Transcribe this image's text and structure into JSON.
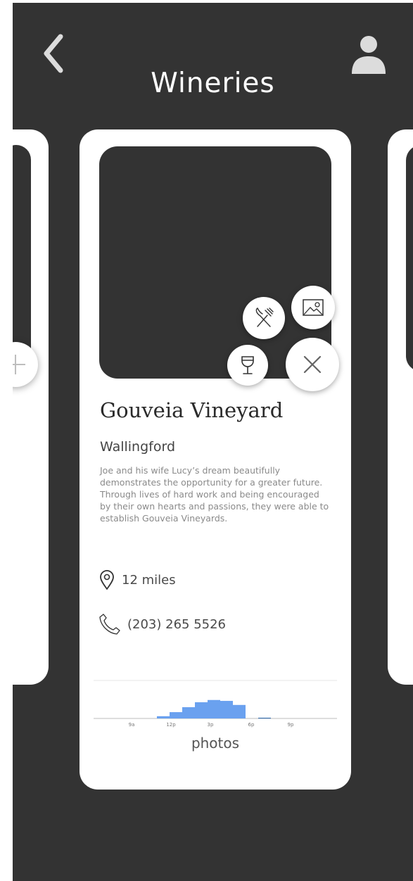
{
  "header": {
    "title": "Wineries",
    "back_icon": "chevron-left-icon",
    "profile_icon": "user-icon"
  },
  "card": {
    "name": "Gouveia Vineyard",
    "location": "Wallingford",
    "description": "Joe and his wife Lucy’s dream beautifully demonstrates the opportunity for a greater future. Through lives of hard work and being encouraged by their own hearts and passions, they were able to establish Gouveia Vineyards.",
    "distance": "12 miles",
    "phone": "(203) 265 5526",
    "photos_label": "photos",
    "actions": [
      "dining-icon",
      "photo-icon",
      "wine-glass-icon",
      "close-icon"
    ]
  },
  "colors": {
    "background": "#333333",
    "card": "#ffffff",
    "bar": "#6aa1ef",
    "bar_dark": "#1f5fa8"
  },
  "chart_data": {
    "type": "bar",
    "xlabel": "",
    "ylabel": "",
    "tick_labels": [
      "9a",
      "12p",
      "3p",
      "6p",
      "9p"
    ],
    "values": [
      0,
      0,
      0,
      0,
      0,
      0.1,
      0.28,
      0.5,
      0.72,
      0.82,
      0.78,
      0.6,
      0,
      0.03,
      0,
      0,
      0,
      0,
      0,
      0
    ]
  }
}
